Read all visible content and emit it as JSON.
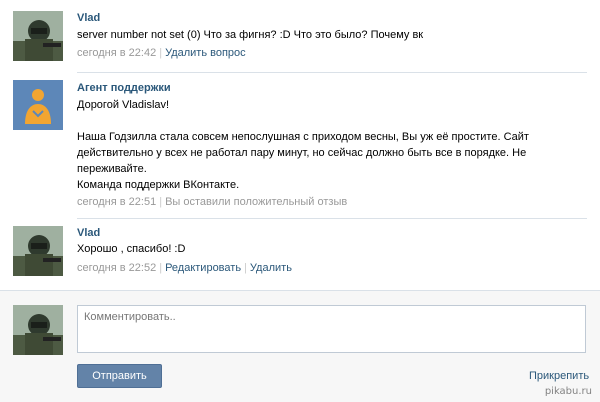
{
  "messages": [
    {
      "author": "Vlad",
      "text": "server number not set (0) Что за фигня? :D Что это было? Почему вк",
      "time": "сегодня в 22:42",
      "actions": [
        "Удалить вопрос"
      ],
      "avatar_icon": "soldier-avatar-icon"
    },
    {
      "author": "Агент поддержки",
      "greeting": "Дорогой Vladislav!",
      "paragraph": "Наша Годзилла стала совсем непослушная с приходом весны, Вы уж её простите. Сайт действительно у всех не работал пару минут, но сейчас должно быть все в порядке. Не переживайте.",
      "signature": "Команда поддержки ВКонтакте.",
      "time": "сегодня в 22:51",
      "actions": [
        "Вы оставили положительный отзыв"
      ],
      "avatar_icon": "support-agent-avatar-icon"
    },
    {
      "author": "Vlad",
      "text": "Хорошо , спасибо! :D",
      "time": "сегодня в 22:52",
      "actions": [
        "Редактировать",
        "Удалить"
      ],
      "avatar_icon": "soldier-avatar-icon"
    }
  ],
  "composer": {
    "placeholder": "Комментировать..",
    "send_label": "Отправить",
    "attach_label": "Прикрепить"
  },
  "watermark": "pikabu.ru",
  "colors": {
    "link": "#2b587a",
    "meta": "#999999",
    "button": "#6383a8",
    "support_avatar_bg": "#5d87b8",
    "support_avatar_figure": "#f2a531"
  }
}
